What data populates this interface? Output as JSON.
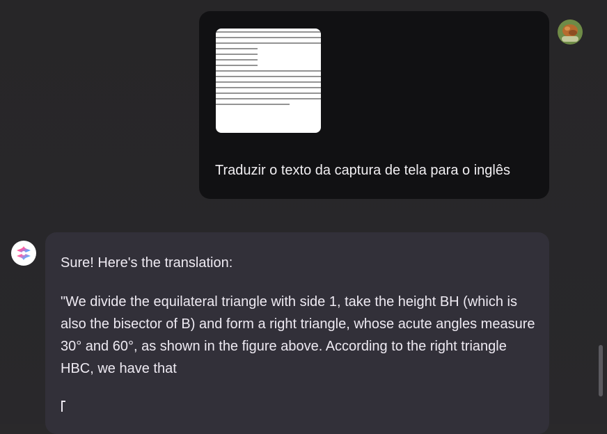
{
  "conversation": {
    "user_message": {
      "text": "Traduzir o texto da captura de tela para o inglês",
      "attachment_label": "screenshot"
    },
    "assistant_message": {
      "intro": "Sure! Here's the translation:",
      "paragraph": "\"We divide the equilateral triangle with side 1, take the height BH (which is also the bisector of B) and form a right triangle, whose acute angles measure 30° and 60°, as shown in the figure above. According to the right triangle HBC, we have that"
    }
  },
  "colors": {
    "background": "#29282b",
    "user_bubble": "#111113",
    "assistant_bubble": "#323039",
    "text": "#eeeaf2"
  },
  "icons": {
    "user_avatar": "user-avatar",
    "assistant_avatar": "assistant-logo-icon"
  }
}
